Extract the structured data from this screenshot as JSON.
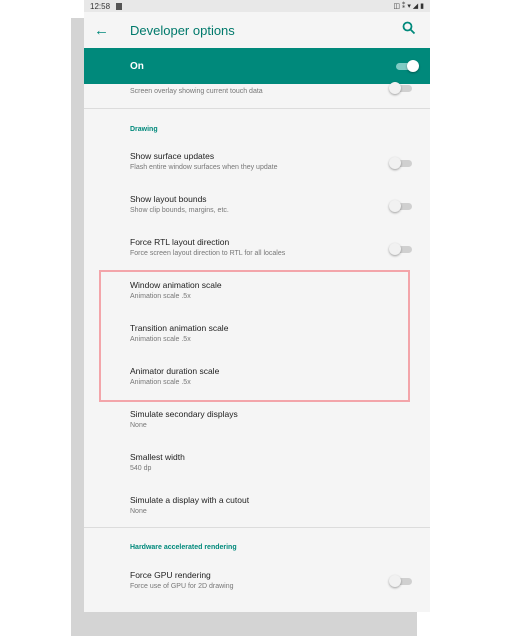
{
  "status_bar": {
    "time": "12:58",
    "icons": "◫ ⁑ ▾ ◢ ▮"
  },
  "app_bar": {
    "title": "Developer options"
  },
  "master_switch": {
    "label": "On",
    "on": true
  },
  "partial_item": {
    "summary": "Screen overlay showing current touch data"
  },
  "drawing": {
    "category": "Drawing",
    "items": [
      {
        "title": "Show surface updates",
        "summary": "Flash entire window surfaces when they update"
      },
      {
        "title": "Show layout bounds",
        "summary": "Show clip bounds, margins, etc."
      },
      {
        "title": "Force RTL layout direction",
        "summary": "Force screen layout direction to RTL for all locales"
      },
      {
        "title": "Window animation scale",
        "summary": "Animation scale .5x"
      },
      {
        "title": "Transition animation scale",
        "summary": "Animation scale .5x"
      },
      {
        "title": "Animator duration scale",
        "summary": "Animation scale .5x"
      },
      {
        "title": "Simulate secondary displays",
        "summary": "None"
      },
      {
        "title": "Smallest width",
        "summary": "540 dp"
      },
      {
        "title": "Simulate a display with a cutout",
        "summary": "None"
      }
    ]
  },
  "hardware": {
    "category": "Hardware accelerated rendering",
    "items": [
      {
        "title": "Force GPU rendering",
        "summary": "Force use of GPU for 2D drawing"
      }
    ]
  },
  "colors": {
    "accent": "#00897b",
    "highlight": "#f3a5aa"
  }
}
